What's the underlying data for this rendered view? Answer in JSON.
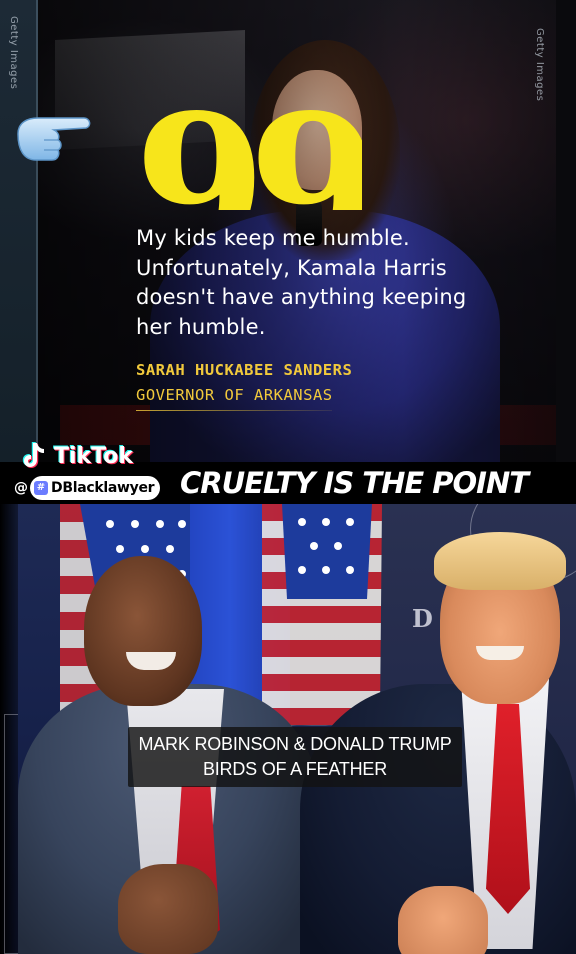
{
  "watermark": {
    "getty_left": "Getty Images",
    "getty_right": "Getty Images"
  },
  "top_card": {
    "quote_mark": "99",
    "quote_lines": [
      "My kids keep me humble.",
      "Unfortunately, Kamala Harris",
      "doesn't have anything keeping",
      "her humble."
    ],
    "speaker_name": "SARAH HUCKABEE SANDERS",
    "speaker_role": "GOVERNOR OF ARKANSAS",
    "quote_color": "#f7e51b",
    "name_color": "#f1c93c"
  },
  "overlay": {
    "title": "CRUELTY IS THE POINT",
    "tiktok_brand": "TikTok",
    "at": "@",
    "username": "DBlacklawyer"
  },
  "bottom_card": {
    "seal_letter": "D",
    "caption_lines": [
      "MARK ROBINSON & DONALD TRUMP",
      "BIRDS OF A FEATHER"
    ]
  },
  "icons": {
    "pointing_hand": "pointing-right-hand-icon",
    "tiktok": "tiktok-note-icon",
    "badge": "hashtag-badge-icon"
  }
}
